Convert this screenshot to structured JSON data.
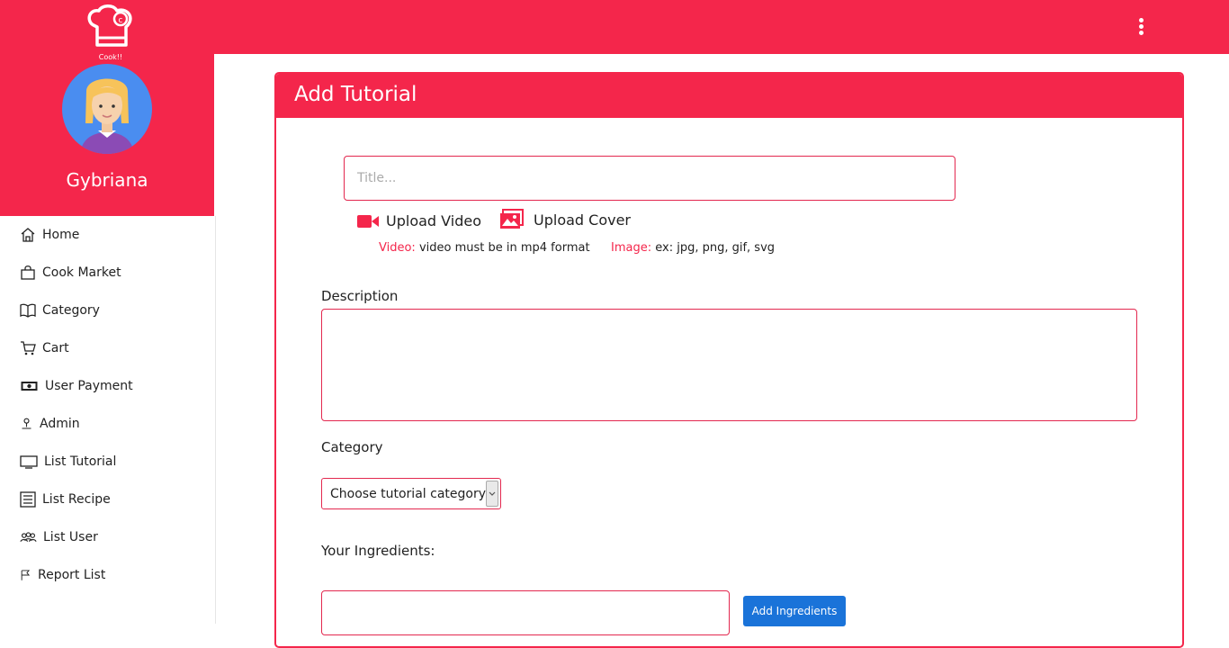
{
  "brand": {
    "logo_text": "Cook!!",
    "accent_color": "#f4264b"
  },
  "header": {
    "menu_icon": "kebab-menu-icon"
  },
  "user": {
    "name": "Gybriana"
  },
  "sidebar": {
    "items": [
      {
        "label": "Home",
        "icon": "home-icon"
      },
      {
        "label": "Cook Market",
        "icon": "bag-icon"
      },
      {
        "label": "Category",
        "icon": "book-icon"
      },
      {
        "label": "Cart",
        "icon": "cart-icon"
      },
      {
        "label": "User Payment",
        "icon": "money-icon"
      },
      {
        "label": "Admin",
        "icon": "person-icon"
      },
      {
        "label": "List Tutorial",
        "icon": "monitor-icon"
      },
      {
        "label": "List Recipe",
        "icon": "list-icon"
      },
      {
        "label": "List User",
        "icon": "people-icon"
      },
      {
        "label": "Report List",
        "icon": "flag-icon"
      }
    ]
  },
  "form": {
    "title": "Add Tutorial",
    "title_placeholder": "Title...",
    "upload_video_label": "Upload Video",
    "upload_cover_label": "Upload Cover",
    "video_hint_key": "Video:",
    "video_hint_text": " video must be in mp4 format",
    "image_hint_key": "Image:",
    "image_hint_text": " ex: jpg, png, gif, svg",
    "description_label": "Description",
    "category_label": "Category",
    "category_selected": "Choose tutorial category",
    "ingredients_label": "Your Ingredients:",
    "add_ingredients_label": "Add Ingredients"
  }
}
